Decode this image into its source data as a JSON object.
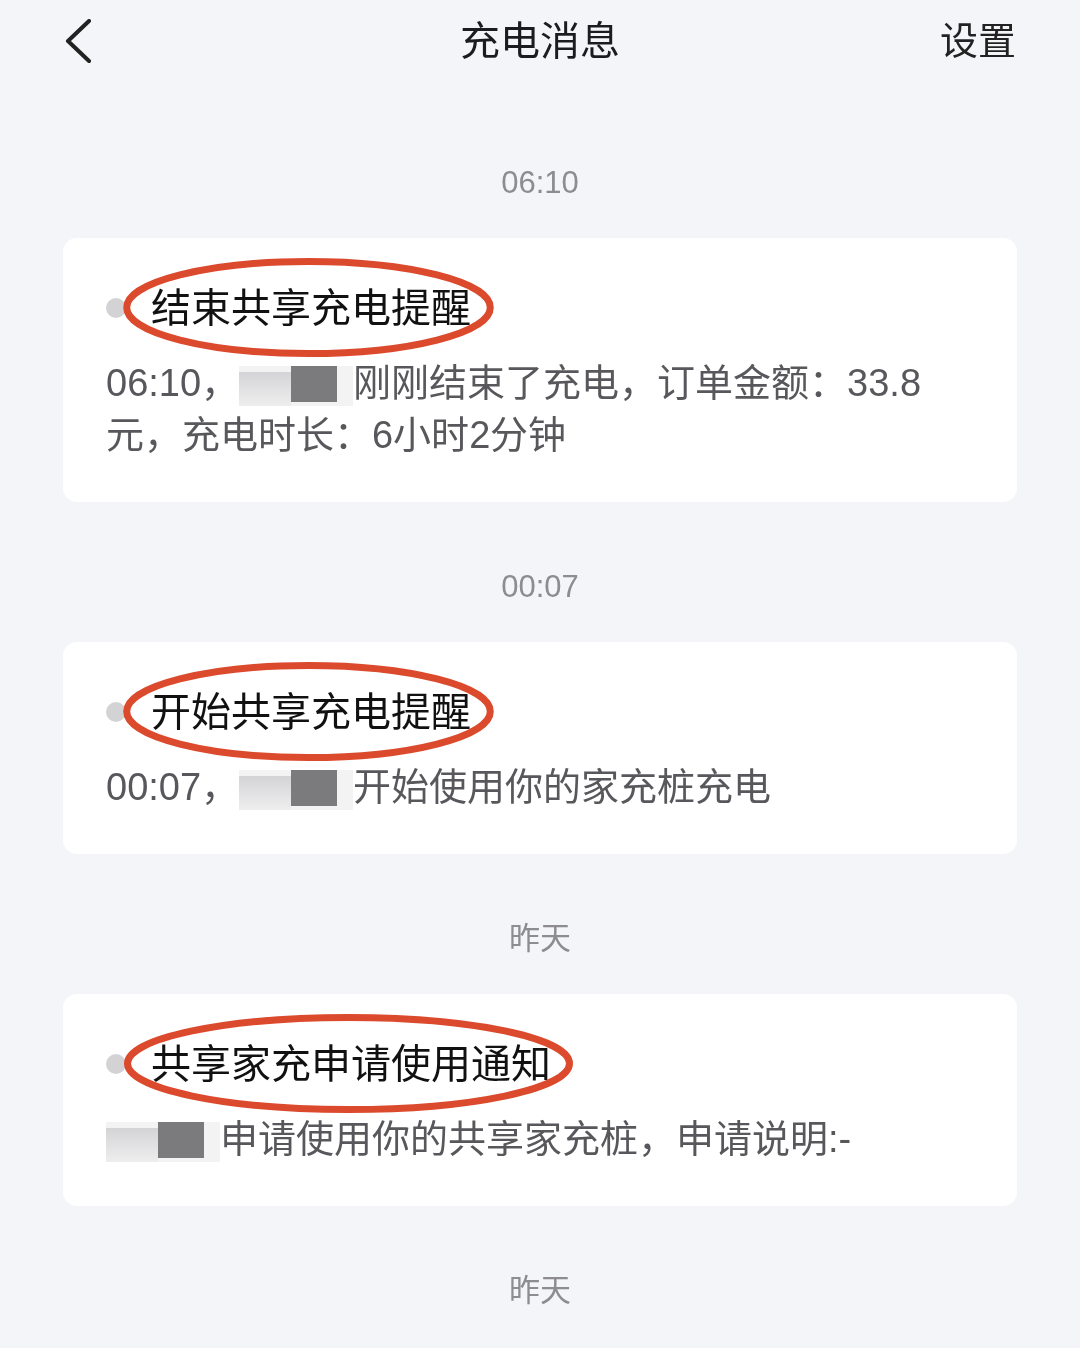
{
  "header": {
    "title": "充电消息",
    "action": "设置"
  },
  "groups": [
    {
      "time": "06:10",
      "messages": [
        {
          "title": "结束共享充电提醒",
          "circled": true,
          "body": [
            {
              "kind": "text",
              "text": "06:10，"
            },
            {
              "kind": "redacted"
            },
            {
              "kind": "text",
              "text": "刚刚结束了充电，订单金额：33.8元，充电时长：6小时2分钟"
            }
          ]
        }
      ]
    },
    {
      "time": "00:07",
      "messages": [
        {
          "title": "开始共享充电提醒",
          "circled": true,
          "body": [
            {
              "kind": "text",
              "text": "00:07，"
            },
            {
              "kind": "redacted"
            },
            {
              "kind": "text",
              "text": "开始使用你的家充桩充电"
            }
          ]
        }
      ]
    },
    {
      "time": "昨天",
      "messages": [
        {
          "title": "共享家充申请使用通知",
          "circled": true,
          "body": [
            {
              "kind": "redacted"
            },
            {
              "kind": "text",
              "text": "申请使用你的共享家充桩，申请说明:-"
            }
          ]
        }
      ]
    },
    {
      "time": "昨天"
    }
  ]
}
